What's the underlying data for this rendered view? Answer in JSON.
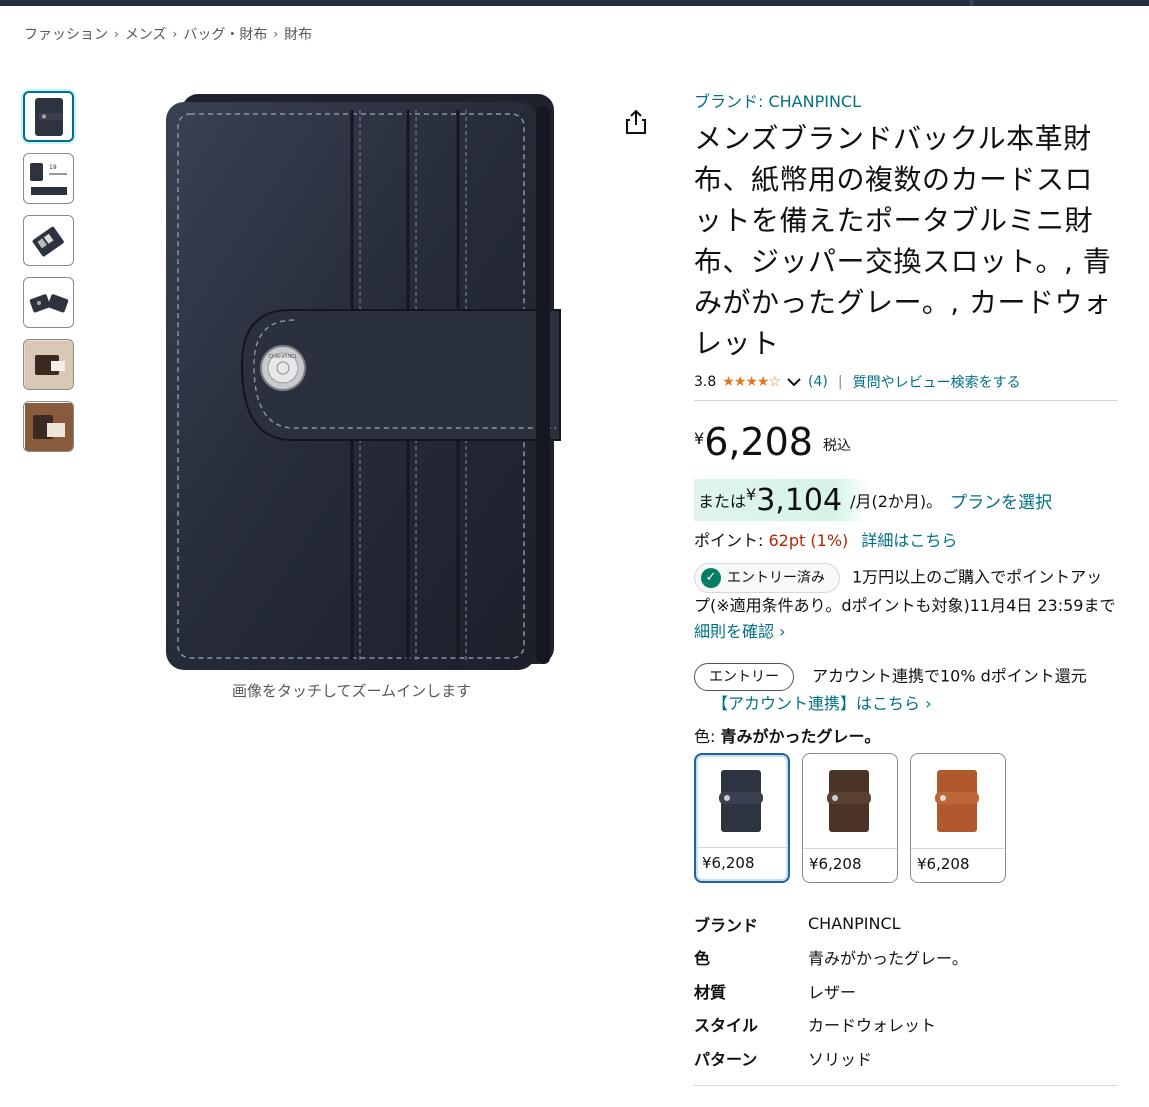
{
  "breadcrumb": [
    "ファッション",
    "メンズ",
    "バッグ・財布",
    "財布"
  ],
  "breadcrumb_separator": "›",
  "thumbnails": [
    "thumb-1",
    "thumb-2",
    "thumb-3",
    "thumb-4",
    "thumb-5",
    "thumb-6"
  ],
  "main_image": {
    "zoom_hint": "画像をタッチしてズームインします",
    "logo_text": "CHANPINCL"
  },
  "product": {
    "brand_link": "ブランド: CHANPINCL",
    "title": "メンズブランドバックル本革財布、紙幣用の複数のカードスロットを備えたポータブルミニ財布、ジッパー交換スロット。, 青みがかったグレー。, カードウォレット",
    "rating": "3.8",
    "stars": "★★★★☆",
    "review_count": "(4)",
    "rating_separator": "|",
    "qa_link": "質問やレビュー検索をする"
  },
  "price": {
    "yen": "¥",
    "amount": "6,208",
    "tax": "税込"
  },
  "installment": {
    "or": "または",
    "yen": "¥",
    "amount": "3,104",
    "per": "/月(2か月)。",
    "plan_link": "プランを選択"
  },
  "points": {
    "label": "ポイント:",
    "value": "62pt",
    "percent": "(1%)",
    "detail_link": "詳細はこちら"
  },
  "promo1": {
    "pill": "エントリー済み",
    "text": "1万円以上のご購入でポイントアップ(※適用条件あり。dポイントも対象)11月4日 23:59まで",
    "link": "細則を確認 ›"
  },
  "promo2": {
    "pill": "エントリー",
    "text": "アカウント連携で10% dポイント還元",
    "link": "【アカウント連携】はこちら ›"
  },
  "color": {
    "label": "色:",
    "selected": "青みがかったグレー。",
    "swatches": [
      {
        "price": "¥6,208",
        "color": "#2e3340"
      },
      {
        "price": "¥6,208",
        "color": "#4a3428"
      },
      {
        "price": "¥6,208",
        "color": "#b2582f"
      }
    ]
  },
  "specs": [
    {
      "key": "ブランド",
      "value": "CHANPINCL"
    },
    {
      "key": "色",
      "value": "青みがかったグレー。"
    },
    {
      "key": "材質",
      "value": "レザー"
    },
    {
      "key": "スタイル",
      "value": "カードウォレット"
    },
    {
      "key": "パターン",
      "value": "ソリッド"
    }
  ],
  "colors": {
    "link": "#007185",
    "price_red": "#b12704",
    "stars": "#de7921",
    "wallet": "#2e3340"
  }
}
